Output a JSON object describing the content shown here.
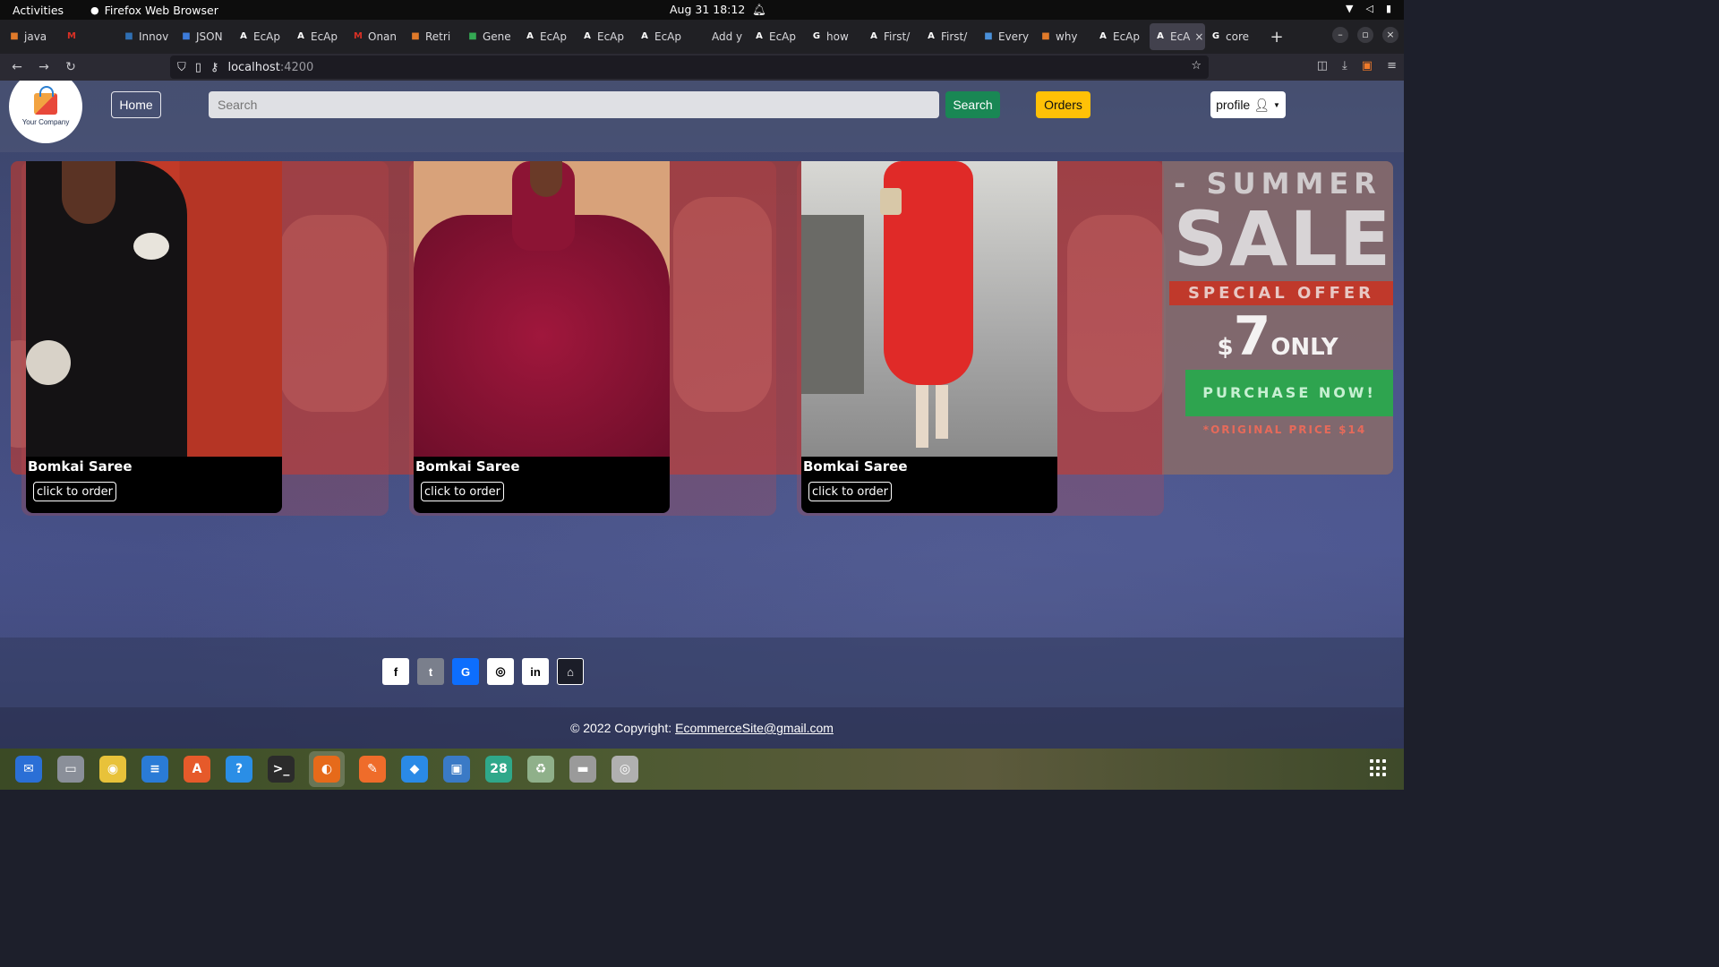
{
  "system": {
    "activities": "Activities",
    "app_name": "Firefox Web Browser",
    "clock": "Aug 31  18:12"
  },
  "tabs": [
    {
      "label": "java",
      "icon": "java-icon",
      "color": "#e07a2a"
    },
    {
      "label": "",
      "icon": "gmail-icon",
      "color": "#d93025"
    },
    {
      "label": "Innov",
      "icon": "innov-icon",
      "color": "#2f6fb3"
    },
    {
      "label": "JSON",
      "icon": "json-icon",
      "color": "#3d7bd9"
    },
    {
      "label": "EcAp",
      "icon": "angular-icon",
      "color": "#ffffff"
    },
    {
      "label": "EcAp",
      "icon": "angular-icon",
      "color": "#ffffff"
    },
    {
      "label": "Onan",
      "icon": "gmail-icon",
      "color": "#d93025"
    },
    {
      "label": "Retri",
      "icon": "java-icon",
      "color": "#e07a2a"
    },
    {
      "label": "Gene",
      "icon": "sheet-icon",
      "color": "#34a853"
    },
    {
      "label": "EcAp",
      "icon": "angular-icon",
      "color": "#ffffff"
    },
    {
      "label": "EcAp",
      "icon": "angular-icon",
      "color": "#ffffff"
    },
    {
      "label": "EcAp",
      "icon": "angular-icon",
      "color": "#ffffff"
    },
    {
      "label": "Add y",
      "icon": "blank-icon",
      "color": "#202024"
    },
    {
      "label": "EcAp",
      "icon": "angular-icon",
      "color": "#ffffff"
    },
    {
      "label": "how",
      "icon": "google-icon",
      "color": "#ffffff"
    },
    {
      "label": "First/",
      "icon": "angular-icon",
      "color": "#ffffff"
    },
    {
      "label": "First/",
      "icon": "angular-icon",
      "color": "#ffffff"
    },
    {
      "label": "Every",
      "icon": "image-icon",
      "color": "#4a90d9"
    },
    {
      "label": "why",
      "icon": "java-icon",
      "color": "#e07a2a"
    },
    {
      "label": "EcAp",
      "icon": "angular-icon",
      "color": "#ffffff"
    },
    {
      "label": "EcA",
      "icon": "angular-icon",
      "color": "#ffffff",
      "active": true
    },
    {
      "label": "core",
      "icon": "google-icon",
      "color": "#ffffff"
    }
  ],
  "urlbar": {
    "host": "localhost",
    "port": ":4200"
  },
  "header": {
    "logo_text": "Your Company",
    "home_label": "Home",
    "search_placeholder": "Search",
    "search_button": "Search",
    "orders_button": "Orders",
    "profile_button": "profile"
  },
  "banner": {
    "sale_top": "- SUMMER",
    "sale_big": "SALE",
    "ribbon": "SPECIAL OFFER",
    "price_currency": "$",
    "price_value": "7",
    "price_suffix": "ONLY",
    "cta": "PURCHASE NOW!",
    "original": "*ORIGINAL PRICE $14",
    "color": "#c3392c"
  },
  "products": [
    {
      "title": "Bomkai Saree",
      "button": "click to order",
      "image": "black-dress"
    },
    {
      "title": "Bomkai Saree",
      "button": "click to order",
      "image": "maroon-dress"
    },
    {
      "title": "Bomkai Saree",
      "button": "click to order",
      "image": "red-dress"
    }
  ],
  "footer": {
    "social": [
      {
        "name": "facebook-icon",
        "glyph": "f",
        "bg": "#ffffff",
        "fg": "#000000"
      },
      {
        "name": "twitter-icon",
        "glyph": "t",
        "bg": "#7a7f8c",
        "fg": "#ffffff"
      },
      {
        "name": "google-icon",
        "glyph": "G",
        "bg": "#0d6efd",
        "fg": "#ffffff"
      },
      {
        "name": "instagram-icon",
        "glyph": "◎",
        "bg": "#ffffff",
        "fg": "#000000"
      },
      {
        "name": "linkedin-icon",
        "glyph": "in",
        "bg": "#ffffff",
        "fg": "#000000"
      },
      {
        "name": "github-icon",
        "glyph": "⌂",
        "bg": "#1b1d28",
        "fg": "#ffffff"
      }
    ],
    "copyright": "© 2022 Copyright:",
    "email": "EcommerceSite@gmail.com"
  },
  "dock": [
    {
      "name": "thunderbird-icon",
      "color": "#2a6fd6",
      "glyph": "✉"
    },
    {
      "name": "files-icon",
      "color": "#8a8f99",
      "glyph": "▭"
    },
    {
      "name": "rhythmbox-icon",
      "color": "#e8c23a",
      "glyph": "◉"
    },
    {
      "name": "writer-icon",
      "color": "#2a7bd6",
      "glyph": "≡"
    },
    {
      "name": "app-center-icon",
      "color": "#e65a2a",
      "glyph": "A"
    },
    {
      "name": "help-icon",
      "color": "#2a8ee6",
      "glyph": "?"
    },
    {
      "name": "terminal-icon",
      "color": "#2b2b2b",
      "glyph": ">_"
    },
    {
      "name": "firefox-icon",
      "color": "#e66a1a",
      "glyph": "◐",
      "active": true
    },
    {
      "name": "postman-icon",
      "color": "#ef6c2a",
      "glyph": "✎"
    },
    {
      "name": "vscode-icon",
      "color": "#2a8ae6",
      "glyph": "◆"
    },
    {
      "name": "virtualbox-icon",
      "color": "#3a7ac6",
      "glyph": "▣"
    },
    {
      "name": "calendar-icon",
      "color": "#2fa88a",
      "glyph": "28"
    },
    {
      "name": "trash-icon",
      "color": "#8fb08a",
      "glyph": "♻"
    },
    {
      "name": "disk-icon",
      "color": "#9a9a9a",
      "glyph": "▬"
    },
    {
      "name": "optical-drive-icon",
      "color": "#b0b0b0",
      "glyph": "◎"
    }
  ]
}
